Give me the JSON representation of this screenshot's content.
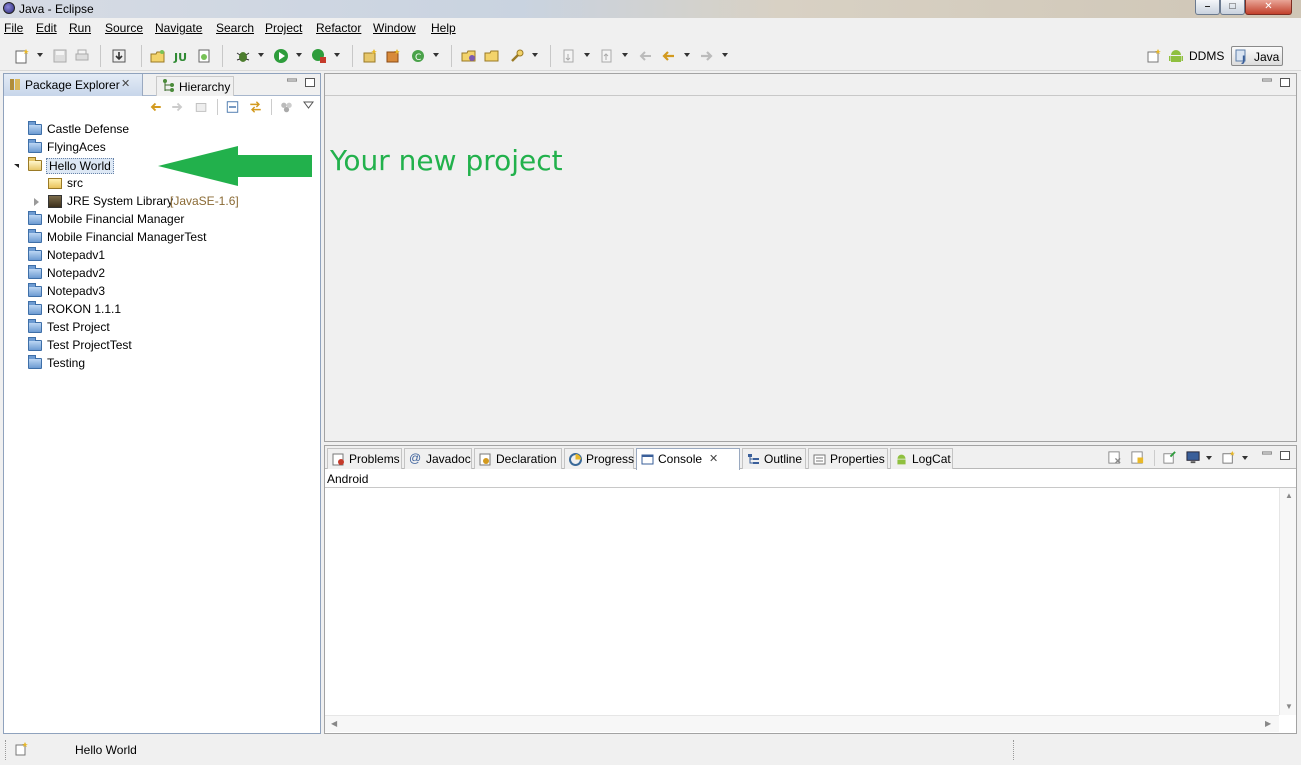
{
  "window": {
    "title": "Java - Eclipse"
  },
  "menu": [
    {
      "label": "File",
      "mnemonic_index": 0
    },
    {
      "label": "Edit",
      "mnemonic_index": 0
    },
    {
      "label": "Run",
      "mnemonic_index": 0
    },
    {
      "label": "Source",
      "mnemonic_index": 0
    },
    {
      "label": "Navigate",
      "mnemonic_index": 0
    },
    {
      "label": "Search",
      "mnemonic_index": 0
    },
    {
      "label": "Project",
      "mnemonic_index": 0
    },
    {
      "label": "Refactor",
      "mnemonic_index": 0
    },
    {
      "label": "Window",
      "mnemonic_index": 0
    },
    {
      "label": "Help",
      "mnemonic_index": 0
    }
  ],
  "perspectives": {
    "ddms": "DDMS",
    "java": "Java"
  },
  "package_explorer": {
    "tab_active": "Package Explorer",
    "tab_inactive": "Hierarchy",
    "tree": [
      {
        "label": "Castle Defense",
        "icon": "project-folder-icon",
        "level": 0
      },
      {
        "label": "FlyingAces",
        "icon": "project-folder-icon",
        "level": 0
      },
      {
        "label": "Hello World",
        "icon": "open-project-folder-icon",
        "level": 0,
        "expanded": true,
        "selected": true
      },
      {
        "label": "src",
        "icon": "source-folder-icon",
        "level": 1
      },
      {
        "label": "JRE System Library",
        "decoration": "[JavaSE-1.6]",
        "icon": "library-icon",
        "level": 1,
        "collapsed": true
      },
      {
        "label": "Mobile Financial Manager",
        "icon": "project-folder-icon",
        "level": 0
      },
      {
        "label": "Mobile Financial ManagerTest",
        "icon": "project-folder-icon",
        "level": 0
      },
      {
        "label": "Notepadv1",
        "icon": "project-folder-icon",
        "level": 0
      },
      {
        "label": "Notepadv2",
        "icon": "project-folder-icon",
        "level": 0
      },
      {
        "label": "Notepadv3",
        "icon": "project-folder-icon",
        "level": 0
      },
      {
        "label": "ROKON 1.1.1",
        "icon": "project-folder-icon",
        "level": 0
      },
      {
        "label": "Test Project",
        "icon": "project-folder-icon",
        "level": 0
      },
      {
        "label": "Test ProjectTest",
        "icon": "project-folder-icon",
        "level": 0
      },
      {
        "label": "Testing",
        "icon": "project-folder-icon",
        "level": 0
      }
    ]
  },
  "annotation": {
    "text": "Your new project",
    "color": "#22b14c"
  },
  "console": {
    "tabs": [
      {
        "label": "Problems",
        "icon": "problems-icon"
      },
      {
        "label": "Javadoc",
        "icon": "javadoc-icon"
      },
      {
        "label": "Declaration",
        "icon": "declaration-icon"
      },
      {
        "label": "Progress",
        "icon": "progress-icon"
      },
      {
        "label": "Console",
        "icon": "console-icon",
        "active": true
      },
      {
        "label": "Outline",
        "icon": "outline-icon"
      },
      {
        "label": "Properties",
        "icon": "properties-icon"
      },
      {
        "label": "LogCat",
        "icon": "android-icon"
      }
    ],
    "subtitle": "Android"
  },
  "status": {
    "text": "Hello World"
  },
  "colors": {
    "accent": "#22b14c",
    "selection": "#dde8f5",
    "view_border": "#8fa2bd"
  }
}
